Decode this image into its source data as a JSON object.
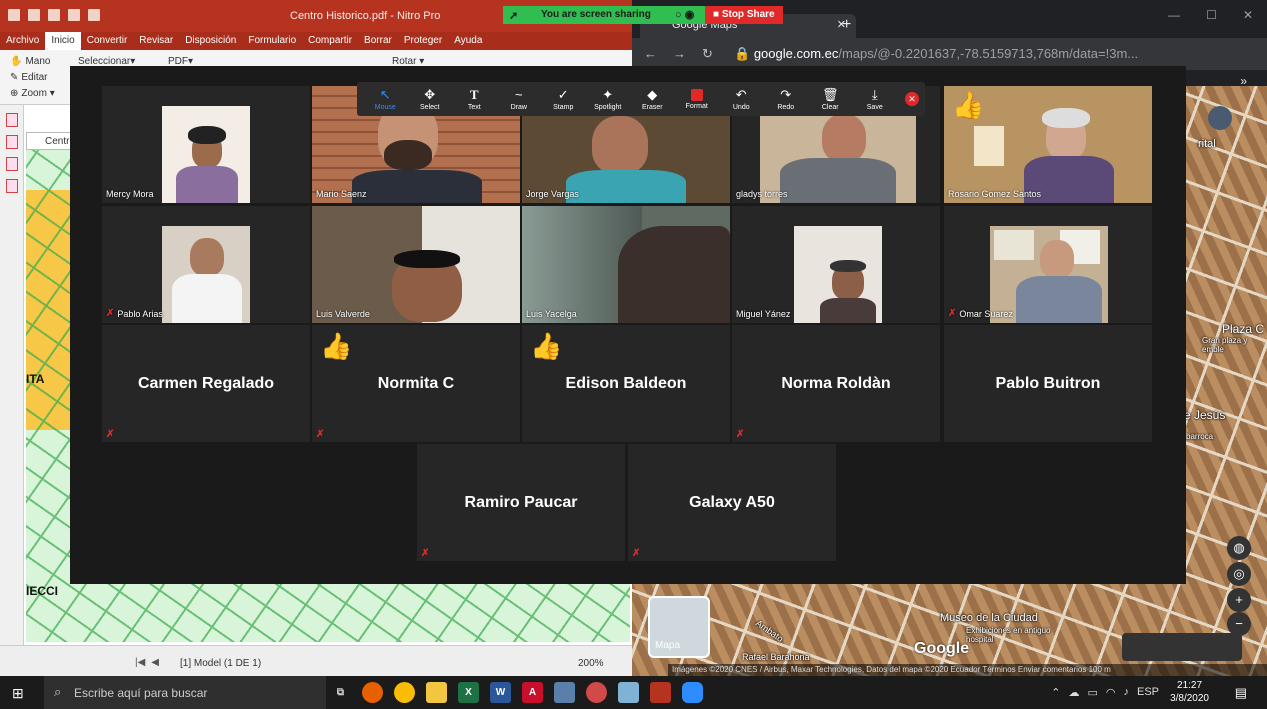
{
  "nitro": {
    "window_title": "Centro Historico.pdf - Nitro Pro",
    "menu": [
      "Archivo",
      "Inicio",
      "Convertir",
      "Revisar",
      "Disposición",
      "Formulario",
      "Compartir",
      "Borrar",
      "Proteger",
      "Ayuda"
    ],
    "tools": {
      "hand": "Mano",
      "edit": "Editar",
      "zoom": "Zoom ▾",
      "select": "Seleccionar▾",
      "pdf": "PDF▾",
      "rotate": "Rotar ▾"
    },
    "doc_tab": "Centro",
    "map_labels": [
      "ITA",
      "IECCI"
    ],
    "status": {
      "page": "[1] Model (1 DE 1)",
      "zoom": "200%"
    }
  },
  "chrome": {
    "tab_title": "Google Maps",
    "url_host": "google.com.ec",
    "url_rest": "/maps/@-0.2201637,-78.5159713,768m/data=!3m...",
    "map_labels": {
      "museo": "Museo de la Ciudad",
      "museo_sub": "Exhibiciones en antiguo hospital",
      "plaza": "Plaza C",
      "plaza_sub": "Gran plaza y emble",
      "jesus": "e Jesús",
      "jesus_sub": "barroca",
      "rafael": "Rafael Barahona",
      "ambato": "Ambato",
      "rital": "rital"
    },
    "minimap_label": "Mapa",
    "google": "Google",
    "footer": "Imágenes ©2020 CNES / Airbus, Maxar Technologies, Datos del mapa ©2020   Ecuador   Términos   Enviar comentarios   100 m"
  },
  "sharebar": {
    "sharing_text": "You are screen sharing",
    "stop_label": "Stop Share"
  },
  "annotation_tools": [
    {
      "label": "Mouse",
      "glyph": "↖"
    },
    {
      "label": "Select",
      "glyph": "✥"
    },
    {
      "label": "Text",
      "glyph": "T"
    },
    {
      "label": "Draw",
      "glyph": "~"
    },
    {
      "label": "Stamp",
      "glyph": "✓"
    },
    {
      "label": "Spotlight",
      "glyph": "✦"
    },
    {
      "label": "Eraser",
      "glyph": "◆"
    },
    {
      "label": "Format",
      "glyph": ""
    },
    {
      "label": "Undo",
      "glyph": "↶"
    },
    {
      "label": "Redo",
      "glyph": "↷"
    },
    {
      "label": "Clear",
      "glyph": "🗑"
    },
    {
      "label": "Save",
      "glyph": "⤓"
    }
  ],
  "participants": [
    {
      "name": "Mercy Mora"
    },
    {
      "name": "Mario Saenz"
    },
    {
      "name": "Jorge Vargas"
    },
    {
      "name": "gladys torres"
    },
    {
      "name": "Rosario Gomez Santos"
    },
    {
      "name": "Pablo Arias"
    },
    {
      "name": "Luis Valverde"
    },
    {
      "name": "Luis Yacelga"
    },
    {
      "name": "Miguel Yánez"
    },
    {
      "name": "Omar Suarez"
    },
    {
      "name": "Carmen Regalado"
    },
    {
      "name": "Normita C"
    },
    {
      "name": "Edison Baldeon"
    },
    {
      "name": "Norma Roldàn"
    },
    {
      "name": "Pablo Buitron"
    },
    {
      "name": "Ramiro Paucar"
    },
    {
      "name": "Galaxy A50"
    }
  ],
  "reactions": {
    "thumbs_up": "👍"
  },
  "taskbar": {
    "search_placeholder": "Escribe aquí para buscar",
    "lang": "ESP",
    "time": "21:27",
    "date": "3/8/2020"
  },
  "colors": {
    "zoom_active_blue": "#2d8cff",
    "share_green": "#2fbe4f",
    "stop_red": "#e02a2a",
    "active_speaker": "#d8e86b",
    "nitro_red": "#b6331f"
  }
}
